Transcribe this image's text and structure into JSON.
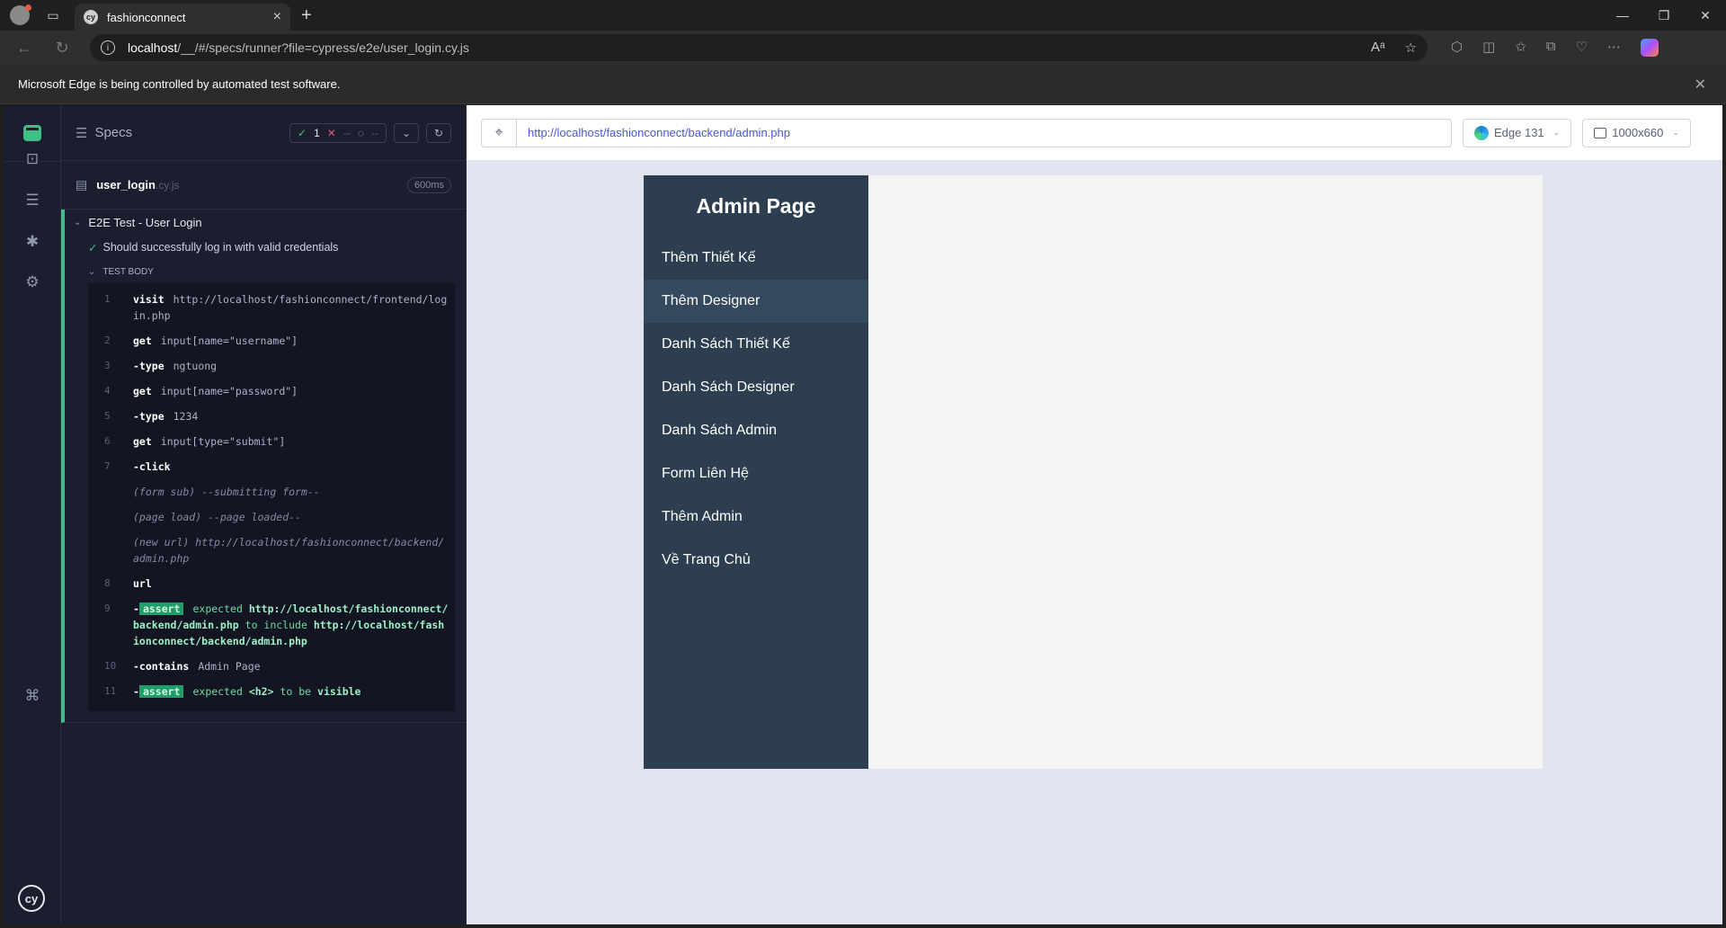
{
  "browser": {
    "tab_title": "fashionconnect",
    "tab_favicon": "cy",
    "address_host": "localhost",
    "address_path": "/__/#/specs/runner?file=cypress/e2e/user_login.cy.js",
    "infobar_text": "Microsoft Edge is being controlled by automated test software."
  },
  "reporter": {
    "specs_label": "Specs",
    "passed_count": "1",
    "failed_count": "--",
    "pending_count": "--",
    "spec_name": "user_login",
    "spec_ext": ".cy.js",
    "duration": "600ms",
    "suite_title": "E2E Test - User Login",
    "test_title": "Should successfully log in with valid credentials",
    "test_body_label": "TEST BODY",
    "commands": [
      {
        "num": "1",
        "kw": "visit",
        "arg": "http://localhost/fashionconnect/frontend/login.php"
      },
      {
        "num": "2",
        "kw": "get",
        "arg": "input[name=\"username\"]"
      },
      {
        "num": "3",
        "kw": "-type",
        "arg": "ngtuong"
      },
      {
        "num": "4",
        "kw": "get",
        "arg": "input[name=\"password\"]"
      },
      {
        "num": "5",
        "kw": "-type",
        "arg": "1234"
      },
      {
        "num": "6",
        "kw": "get",
        "arg": "input[type=\"submit\"]"
      },
      {
        "num": "7",
        "kw": "-click",
        "arg": ""
      },
      {
        "num": "",
        "event": "(form sub)",
        "arg": "--submitting form--"
      },
      {
        "num": "",
        "event": "(page load)",
        "arg": "--page loaded--"
      },
      {
        "num": "",
        "event": "(new url)",
        "arg": "http://localhost/fashionconnect/backend/admin.php"
      },
      {
        "num": "8",
        "kw": "url",
        "arg": ""
      },
      {
        "num": "9",
        "kw": "-",
        "tag": "assert",
        "p1": "expected",
        "p2": "http://localhost/fashionconnect/backend/admin.php",
        "p3": "to include",
        "p4": "http://localhost/fashionconnect/backend/admin.php"
      },
      {
        "num": "10",
        "kw": "-contains",
        "arg": "Admin Page"
      },
      {
        "num": "11",
        "kw": "-",
        "tag": "assert",
        "p1": "expected",
        "p2": "<h2>",
        "p3": "to be",
        "p4": "visible"
      }
    ]
  },
  "aut": {
    "url": "http://localhost/fashionconnect/backend/admin.php",
    "browser_label": "Edge 131",
    "viewport_label": "1000x660",
    "page": {
      "title": "Admin Page",
      "links": [
        "Thêm Thiết Kế",
        "Thêm Designer",
        "Danh Sách Thiết Kế",
        "Danh Sách Designer",
        "Danh Sách Admin",
        "Form Liên Hệ",
        "Thêm Admin",
        "Về Trang Chủ"
      ],
      "active_link_index": 1
    }
  },
  "colors": {
    "pass": "#3fbf86",
    "fail": "#e45770",
    "admin_sidebar": "#2c3e50",
    "url_link": "#4956e3"
  },
  "icons": {
    "nav": [
      "runs-icon",
      "specs-list-icon",
      "debug-icon",
      "settings-icon",
      "keyboard-shortcuts-icon"
    ]
  }
}
